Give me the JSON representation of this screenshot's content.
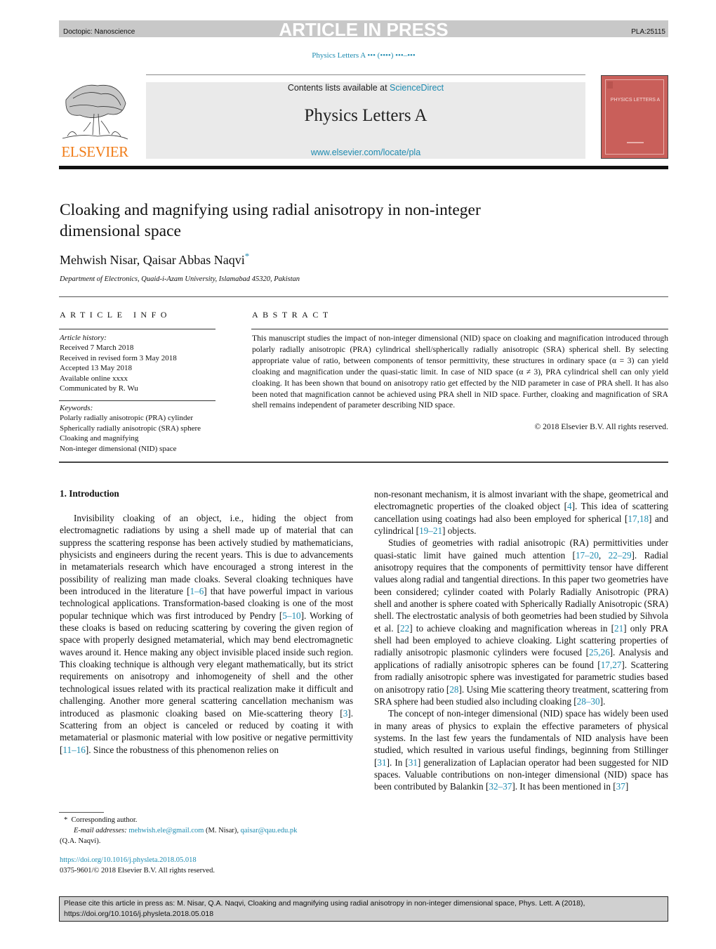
{
  "header": {
    "doctopic": "Doctopic: Nanoscience",
    "banner": "ARTICLE IN PRESS",
    "article_id": "PLA:25115",
    "journal_ref": "Physics Letters A ••• (••••) •••–•••"
  },
  "masthead": {
    "contents_prefix": "Contents lists available at ",
    "contents_link": "ScienceDirect",
    "journal_name": "Physics Letters A",
    "journal_url": "www.elsevier.com/locate/pla",
    "publisher_logo_text": "ELSEVIER",
    "cover_title": "PHYSICS LETTERS A",
    "colors": {
      "link": "#1e8bb0",
      "elsevier_orange": "#f07d1a",
      "cover_red": "#c95f5a"
    }
  },
  "article": {
    "title": "Cloaking and magnifying using radial anisotropy in non-integer dimensional space",
    "authors": "Mehwish Nisar, Qaisar Abbas Naqvi",
    "author_mark": "*",
    "affiliation": "Department of Electronics, Quaid-i-Azam University, Islamabad 45320, Pakistan"
  },
  "article_info": {
    "heading": "ARTICLE INFO",
    "history_label": "Article history:",
    "history": [
      "Received 7 March 2018",
      "Received in revised form 3 May 2018",
      "Accepted 13 May 2018",
      "Available online xxxx",
      "Communicated by R. Wu"
    ],
    "keywords_label": "Keywords:",
    "keywords": [
      "Polarly radially anisotropic (PRA) cylinder",
      "Spherically radially anisotropic (SRA) sphere",
      "Cloaking and magnifying",
      "Non-integer dimensional (NID) space"
    ]
  },
  "abstract": {
    "heading": "ABSTRACT",
    "text": "This manuscript studies the impact of non-integer dimensional (NID) space on cloaking and magnification introduced through polarly radially anisotropic (PRA) cylindrical shell/spherically radially anisotropic (SRA) spherical shell. By selecting appropriate value of ratio, between components of tensor permittivity, these structures in ordinary space (α = 3) can yield cloaking and magnification under the quasi-static limit. In case of NID space (α ≠ 3), PRA cylindrical shell can only yield cloaking. It has been shown that bound on anisotropy ratio get effected by the NID parameter in case of PRA shell. It has also been noted that magnification cannot be achieved using PRA shell in NID space. Further, cloaking and magnification of SRA shell remains independent of parameter describing NID space.",
    "copyright": "© 2018 Elsevier B.V. All rights reserved."
  },
  "body": {
    "section_heading": "1. Introduction",
    "left_paragraphs": [
      [
        {
          "t": "Invisibility cloaking of an object, i.e., hiding the object from electromagnetic radiations by using a shell made up of material that can suppress the scattering response has been actively stud­ied by mathematicians, physicists and engineers during the re­cent years. This is due to advancements in metamaterials research which have encouraged a strong interest in the possibility of re­alizing man made cloaks. Several cloaking techniques have been introduced in the literature ["
        },
        {
          "t": "1–6",
          "ref": true
        },
        {
          "t": "] that have powerful impact in various technological applications. Transformation-based cloaking is one of the most popular technique which was first introduced by Pendry ["
        },
        {
          "t": "5–10",
          "ref": true
        },
        {
          "t": "]. Working of these cloaks is based on reducing scattering by covering the given region of space with properly designed metamaterial, which may bend electromagnetic waves around it. Hence making any object invisible placed inside such region. This cloaking technique is although very elegant mathemat­ically, but its strict requirements on anisotropy and inhomogeneity of shell and the other technological issues related with its prac­tical realization make it difficult and challenging. Another more general scattering cancellation mechanism was introduced as plas­monic cloaking based on Mie-scattering theory ["
        },
        {
          "t": "3",
          "ref": true
        },
        {
          "t": "]. Scattering from an object is canceled or reduced by coating it with metamaterial or plasmonic material with low positive or negative permittiv­ity ["
        },
        {
          "t": "11–16",
          "ref": true
        },
        {
          "t": "]. Since the robustness of this phenomenon relies on"
        }
      ]
    ],
    "right_paragraphs": [
      [
        {
          "t": "non-resonant mechanism, it is almost invariant with the shape, ge­ometrical and electromagnetic properties of the cloaked object ["
        },
        {
          "t": "4",
          "ref": true
        },
        {
          "t": "]. This idea of scattering cancellation using coatings had also been employed for spherical ["
        },
        {
          "t": "17,18",
          "ref": true
        },
        {
          "t": "] and cylindrical ["
        },
        {
          "t": "19–21",
          "ref": true
        },
        {
          "t": "] objects."
        }
      ],
      [
        {
          "t": "Studies of geometries with radial anisotropic (RA) permittivi­ties under quasi-static limit have gained much attention ["
        },
        {
          "t": "17–20",
          "ref": true
        },
        {
          "t": ", "
        },
        {
          "t": "22–29",
          "ref": true
        },
        {
          "t": "]. Radial anisotropy requires that the components of permit­tivity tensor have different values along radial and tangential direc­tions. In this paper two geometries have been considered; cylinder coated with Polarly Radially Anisotropic (PRA) shell and another is sphere coated with Spherically Radially Anisotropic (SRA) shell. The electrostatic analysis of both geometries had been studied by Sihvola et al. ["
        },
        {
          "t": "22",
          "ref": true
        },
        {
          "t": "] to achieve cloaking and magnification whereas in ["
        },
        {
          "t": "21",
          "ref": true
        },
        {
          "t": "] only PRA shell had been employed to achieve cloaking. Light scattering properties of radially anisotropic plasmonic cylin­ders were focused ["
        },
        {
          "t": "25,26",
          "ref": true
        },
        {
          "t": "]. Analysis and applications of radially anisotropic spheres can be found ["
        },
        {
          "t": "17,27",
          "ref": true
        },
        {
          "t": "]. Scattering from radially anisotropic sphere was investigated for parametric studies based on anisotropy ratio ["
        },
        {
          "t": "28",
          "ref": true
        },
        {
          "t": "]. Using Mie scattering theory treatment, scattering from SRA sphere had been studied also including cloak­ing ["
        },
        {
          "t": "28–30",
          "ref": true
        },
        {
          "t": "]."
        }
      ],
      [
        {
          "t": "The concept of non-integer dimensional (NID) space has widely been used in many areas of physics to explain the effective param­eters of physical systems. In the last few years the fundamentals of NID analysis have been studied, which resulted in various use­ful findings, beginning from Stillinger ["
        },
        {
          "t": "31",
          "ref": true
        },
        {
          "t": "]. In ["
        },
        {
          "t": "31",
          "ref": true
        },
        {
          "t": "] generalization of Laplacian operator had been suggested for NID spaces. Valuable contributions on non-integer dimensional (NID) space has been contributed by Balankin ["
        },
        {
          "t": "32–37",
          "ref": true
        },
        {
          "t": "]. It has been mentioned in ["
        },
        {
          "t": "37",
          "ref": true
        },
        {
          "t": "]"
        }
      ]
    ]
  },
  "footnote": {
    "mark": "*",
    "corresponding": "Corresponding author.",
    "email_label": "E-mail addresses:",
    "email_1": "mehwish.ele@gmail.com",
    "email_1_owner": "(M. Nisar),",
    "email_2": "qaisar@qau.edu.pk",
    "email_2_owner": "(Q.A. Naqvi).",
    "doi": "https://doi.org/10.1016/j.physleta.2018.05.018",
    "issn_copyright": "0375-9601/© 2018 Elsevier B.V. All rights reserved."
  },
  "citation_box": {
    "text": "Please cite this article in press as: M. Nisar, Q.A. Naqvi, Cloaking and magnifying using radial anisotropy in non-integer dimensional space, Phys. Lett. A (2018), https://doi.org/10.1016/j.physleta.2018.05.018"
  }
}
